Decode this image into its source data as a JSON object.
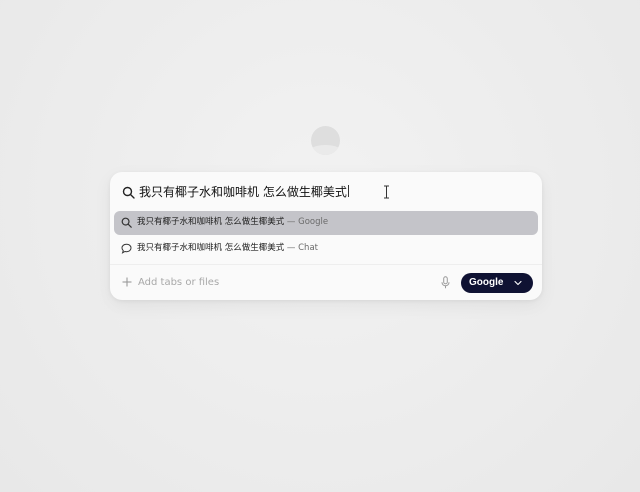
{
  "search": {
    "query": "我只有椰子水和咖啡机 怎么做生椰美式"
  },
  "suggestions": [
    {
      "text": "我只有椰子水和咖啡机 怎么做生椰美式",
      "source": "— Google",
      "icon": "search-icon",
      "highlighted": true
    },
    {
      "text": "我只有椰子水和咖啡机 怎么做生椰美式",
      "source": "— Chat",
      "icon": "chat-bubble-icon",
      "highlighted": false
    }
  ],
  "footer": {
    "add_placeholder": "Add tabs or files",
    "engine_label": "Google"
  },
  "colors": {
    "background": "#eeeeee",
    "panel": "#fafafa",
    "highlight": "#c4c4c9",
    "engine_button": "#0f1233"
  }
}
